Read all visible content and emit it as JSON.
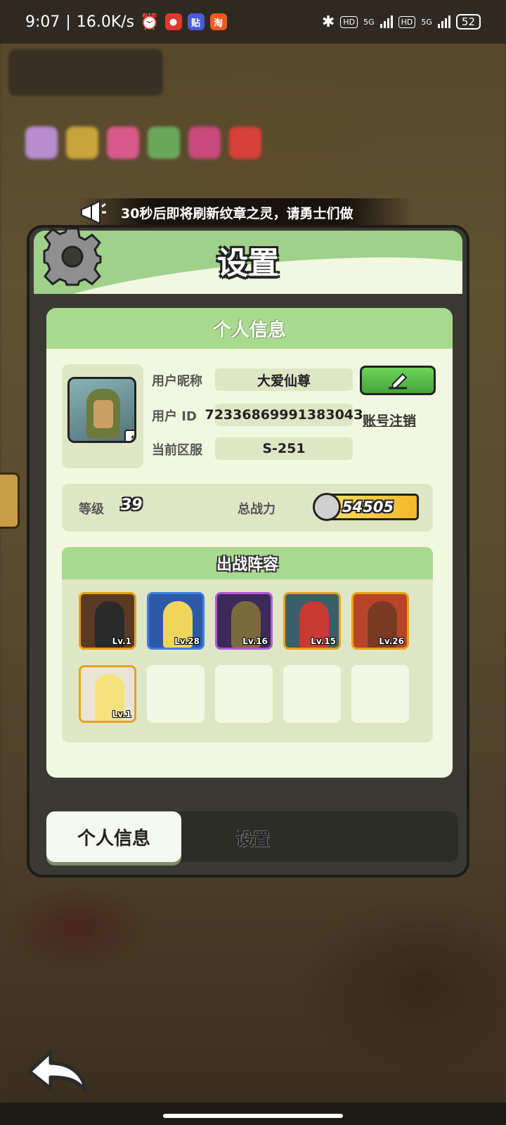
{
  "status_bar": {
    "time": "9:07",
    "net_speed": "16.0K/s",
    "app_icons": [
      "alarm-icon",
      "weibo-icon",
      "tieba-icon",
      "taobao-icon"
    ],
    "app_labels": [
      "贴",
      "淘"
    ],
    "signal_1": "5G",
    "signal_2": "5G",
    "hd_1": "HD",
    "hd_2": "HD",
    "battery": "52"
  },
  "announcement": {
    "text": "30秒后即将刷新纹章之灵，请勇士们做"
  },
  "dialog": {
    "title": "设置",
    "section_title": "个人信息",
    "profile": {
      "nickname_label": "用户昵称",
      "nickname": "大爱仙尊",
      "user_id_label": "用户  ID",
      "user_id": "7233686999138304З",
      "server_label": "当前区服",
      "server": "S-251",
      "cancel_account": "账号注销"
    },
    "stats": {
      "level_label": "等级",
      "level": "39",
      "power_label": "总战力",
      "power": "54505"
    },
    "lineup": {
      "title": "出战阵容",
      "heroes": [
        {
          "level": "Lv.1",
          "frame": "#e8a21b",
          "bg": "#5a3a22",
          "figure": "#2a2a2a"
        },
        {
          "level": "Lv.28",
          "frame": "#3f7ee0",
          "bg": "#2d5aa8",
          "figure": "#f2d35b"
        },
        {
          "level": "Lv.16",
          "frame": "#b15ad8",
          "bg": "#3b2a5a",
          "figure": "#7b6a3a"
        },
        {
          "level": "Lv.15",
          "frame": "#e8a21b",
          "bg": "#3a5f6a",
          "figure": "#c83a32"
        },
        {
          "level": "Lv.26",
          "frame": "#e8a21b",
          "bg": "#b8452a",
          "figure": "#7a3a22"
        },
        {
          "level": "Lv.1",
          "frame": "#e8a21b",
          "bg": "#e9e4d4",
          "figure": "#f5e27a"
        }
      ]
    },
    "tabs": {
      "personal_info": "个人信息",
      "settings": "设置"
    }
  },
  "colors": {
    "panel_header": "#9fd18a",
    "card_bg": "#f1f8df",
    "edit_button": "#4fb441",
    "power_badge": "#f3b72a"
  }
}
